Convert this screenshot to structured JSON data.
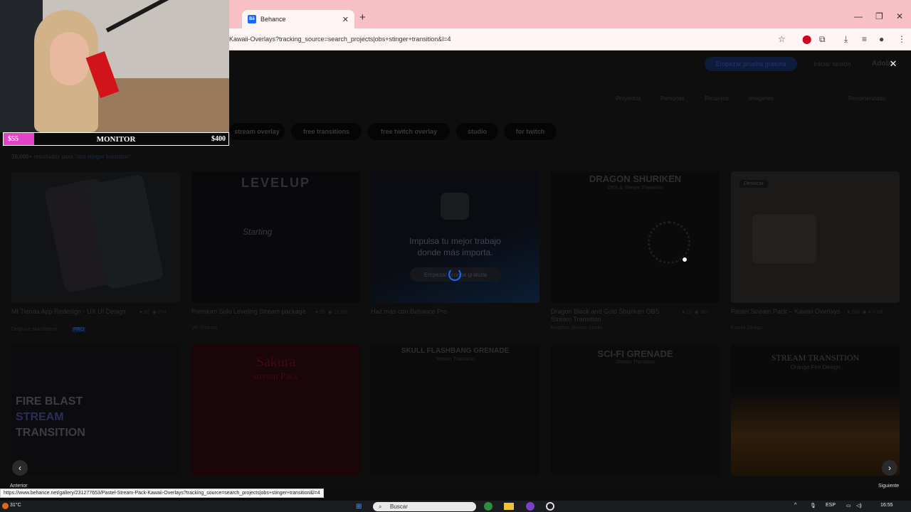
{
  "browser": {
    "tab_title": "Behance",
    "tab_favicon": "Bē",
    "url": "Kawaii-Overlays?tracking_source=search_projects|obs+stinger+transition&l=4"
  },
  "page": {
    "start_button": "Empezar prueba gratuita",
    "login": "Iniciar sesión",
    "adobe": "Adobe",
    "subnav": [
      "Proyectos",
      "Personas",
      "Recursos",
      "Imágenes"
    ],
    "sort": "Recomendado",
    "chips": [
      "stream overlay",
      "free transitions",
      "free twitch overlay",
      "studio",
      "for twitch"
    ],
    "results_count": "10,000+",
    "results_text": "resultados para",
    "results_query": "\"obs stinger transition\"",
    "cards": [
      {
        "title": "MI Tienda App Redesign - UX UI Design",
        "owner": "Delphine Mandelbrot",
        "badge": "PRO",
        "likes": "30",
        "views": "274"
      },
      {
        "title": "Premium Solo Leveling Stream package",
        "owner": "VR Sharma",
        "likes": "55",
        "views": "12 mil",
        "art_title": "LEVELUP",
        "art_sub": "Starting"
      },
      {
        "title": "Haz más con Behance Pro",
        "promo_line1": "Impulsa tu mejor trabajo",
        "promo_line2": "donde más importa.",
        "promo_button": "Empezar prueba gratuita"
      },
      {
        "title": "Dragon Black and Gold Shuriken OBS Stream Transition",
        "owner": "Reaffirm Stream Studio",
        "likes": "18",
        "views": "387",
        "art_title": "DRAGON SHURIKEN",
        "art_sub": "OBS & Stream Transition"
      },
      {
        "title": "Pastel Stream Pack – Kawaii Overlays",
        "owner": "Kawaii Design",
        "likes": "284",
        "views": "4.7 mil",
        "art_badge": "Destacar"
      },
      {
        "art_title": "FIRE BLAST",
        "art_title2": "STREAM",
        "art_title3": "TRANSITION"
      },
      {
        "art_title": "Sakura",
        "art_sub": "stream Pack"
      },
      {
        "art_title": "SKULL FLASHBANG GRENADE",
        "art_sub": "Stream Transition"
      },
      {
        "art_title": "SCI-FI GRENADE",
        "art_sub": "Stream Transition"
      },
      {
        "art_title": "STREAM TRANSITION",
        "art_sub": "Orange Fire Design"
      }
    ],
    "prev_label": "Anterior",
    "next_label": "Siguiente",
    "status_url": "https://www.behance.net/gallery/231277653/Pastel-Stream-Pack-Kawaii-Overlays?tracking_source=search_projects|obs+stinger+transition&l=4"
  },
  "donation_bar": {
    "current": "$55",
    "label": "MONITOR",
    "goal": "$400",
    "progress": 0.1375,
    "fill_color": "#e642c8"
  },
  "taskbar": {
    "weather": "31°C",
    "search_placeholder": "Buscar",
    "language": "ESP",
    "time": "16:55"
  },
  "icons": {
    "modal_close": "close-icon",
    "prev": "chevron-left-icon",
    "next": "chevron-right-icon"
  }
}
